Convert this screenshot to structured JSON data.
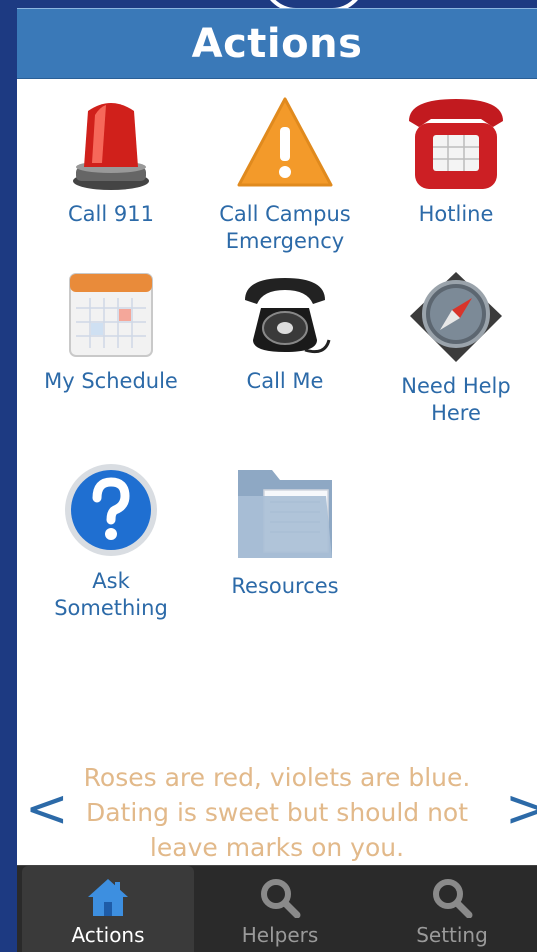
{
  "header": {
    "title": "Actions"
  },
  "actions": [
    {
      "label": "Call 911",
      "icon": "siren-icon"
    },
    {
      "label": "Call Campus\nEmergency",
      "icon": "warning-icon"
    },
    {
      "label": "Hotline",
      "icon": "phone-icon"
    },
    {
      "label": "My Schedule",
      "icon": "calendar-icon"
    },
    {
      "label": "Call Me",
      "icon": "rotary-phone-icon"
    },
    {
      "label": "Need Help\nHere",
      "icon": "compass-icon"
    },
    {
      "label": "Ask\nSomething",
      "icon": "question-icon"
    },
    {
      "label": "Resources",
      "icon": "folder-icon"
    }
  ],
  "quote": {
    "text": "Roses are red, violets are blue. Dating is sweet but should not leave marks on you."
  },
  "carousel": {
    "prev": "<",
    "next": ">"
  },
  "tabs": [
    {
      "label": "Actions",
      "icon": "home-icon",
      "active": true
    },
    {
      "label": "Helpers",
      "icon": "search-icon",
      "active": false
    },
    {
      "label": "Setting",
      "icon": "search-icon",
      "active": false
    }
  ],
  "colors": {
    "header": "#3a79b8",
    "label": "#2c6aa8",
    "quote": "#e2b98a",
    "tabbar": "#2a2a2a",
    "background": "#1d3a82"
  }
}
